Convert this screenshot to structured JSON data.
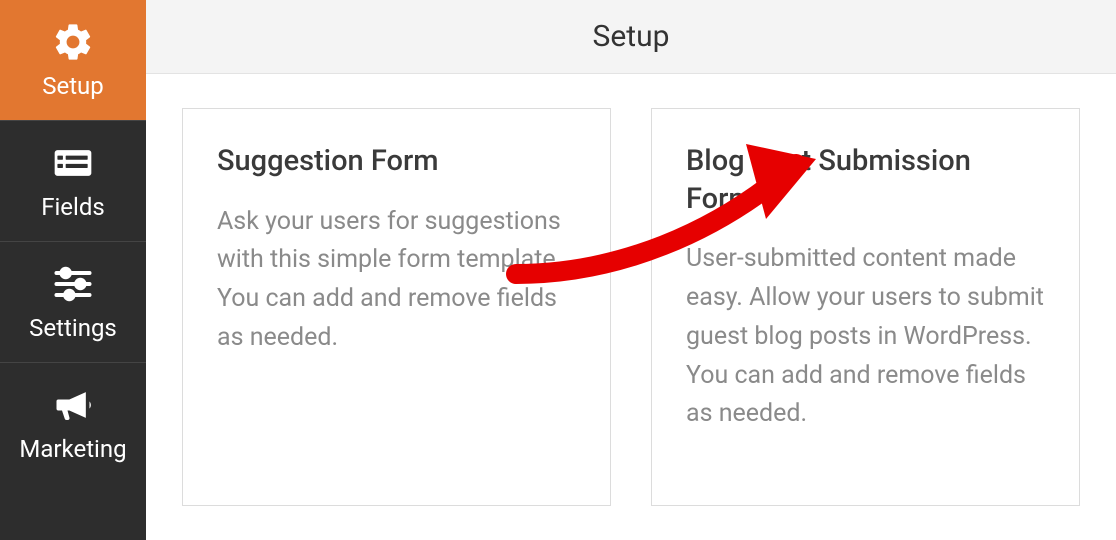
{
  "colors": {
    "accent": "#e27730",
    "sidebar_bg": "#2d2d2d",
    "arrow": "#e60000"
  },
  "sidebar": {
    "items": [
      {
        "label": "Setup",
        "icon": "gear-icon",
        "active": true
      },
      {
        "label": "Fields",
        "icon": "layout-icon",
        "active": false
      },
      {
        "label": "Settings",
        "icon": "sliders-icon",
        "active": false
      },
      {
        "label": "Marketing",
        "icon": "bullhorn-icon",
        "active": false
      }
    ]
  },
  "header": {
    "title": "Setup"
  },
  "cards": [
    {
      "title": "Suggestion Form",
      "description": "Ask your users for suggestions with this simple form template. You can add and remove fields as needed."
    },
    {
      "title": "Blog Post Submission Form",
      "description": "User-submitted content made easy. Allow your users to submit guest blog posts in WordPress. You can add and remove fields as needed."
    }
  ]
}
